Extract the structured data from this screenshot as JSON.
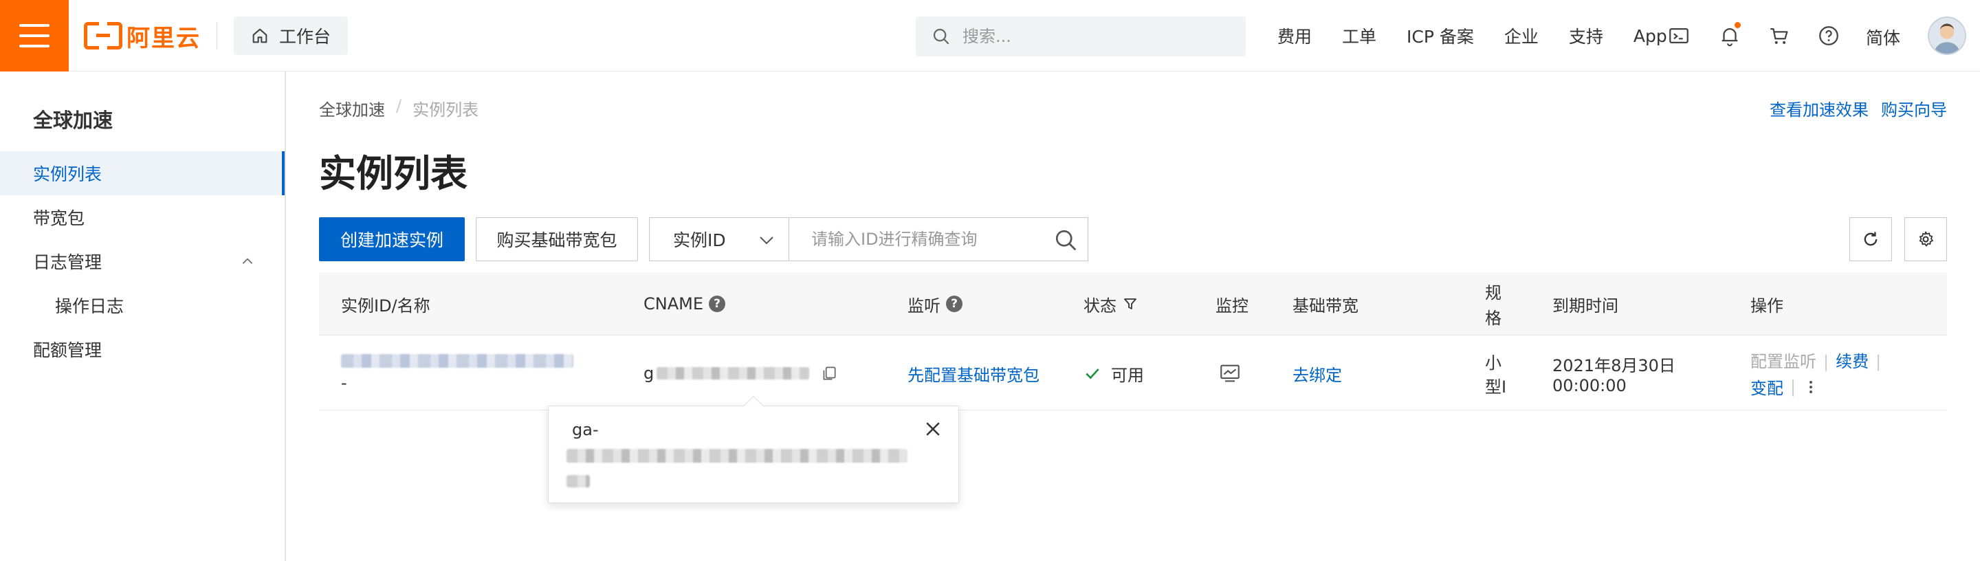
{
  "header": {
    "logo_text": "阿里云",
    "workbench_label": "工作台",
    "search_placeholder": "搜索...",
    "nav": [
      "费用",
      "工单",
      "ICP 备案",
      "企业",
      "支持",
      "App"
    ],
    "lang": "简体"
  },
  "sidebar": {
    "title": "全球加速",
    "items": [
      {
        "label": "实例列表"
      },
      {
        "label": "带宽包"
      },
      {
        "label": "日志管理"
      },
      {
        "label": "操作日志"
      },
      {
        "label": "配额管理"
      }
    ]
  },
  "breadcrumb": {
    "root": "全球加速",
    "sep": "/",
    "current": "实例列表"
  },
  "top_links": {
    "view_effect": "查看加速效果",
    "buy_guide": "购买向导"
  },
  "page_title": "实例列表",
  "toolbar": {
    "create_label": "创建加速实例",
    "buy_bandwidth_label": "购买基础带宽包",
    "filter_select": "实例ID",
    "search_placeholder": "请输入ID进行精确查询"
  },
  "table": {
    "headers": {
      "id_name": "实例ID/名称",
      "cname": "CNAME",
      "listener": "监听",
      "status": "状态",
      "monitor": "监控",
      "bandwidth": "基础带宽",
      "spec_line1": "规",
      "spec_line2": "格",
      "expire": "到期时间",
      "ops": "操作"
    },
    "rows": [
      {
        "name": "-",
        "cname_prefix": "g",
        "listener": "先配置基础带宽包",
        "status": "可用",
        "bandwidth": "去绑定",
        "spec_line1": "小",
        "spec_line2": "型I",
        "expire_date": "2021年8月30日",
        "expire_time": "00:00:00",
        "ops": {
          "config": "配置监听",
          "renew": "续费",
          "change": "变配"
        }
      }
    ]
  },
  "popover": {
    "text": "ga-"
  },
  "colors": {
    "brand": "#ff6a00",
    "primary": "#0064c8",
    "success": "#1e8e3e"
  }
}
